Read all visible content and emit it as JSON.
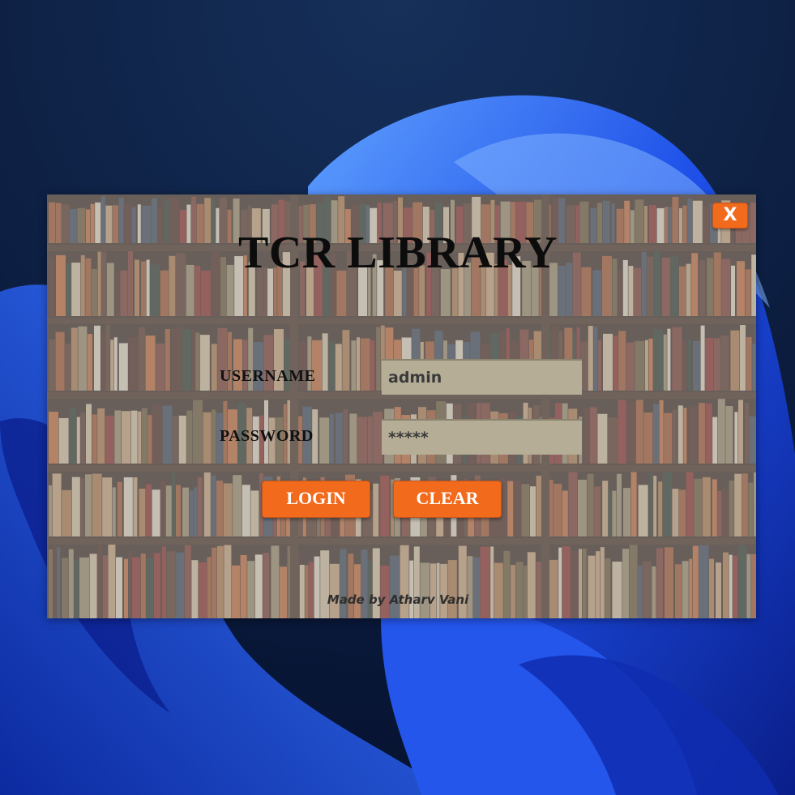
{
  "window": {
    "title": "TCR LIBRARY",
    "close_label": "X"
  },
  "form": {
    "username_label": "USERNAME",
    "username_value": "admin",
    "password_label": "PASSWORD",
    "password_value": "*****"
  },
  "buttons": {
    "login_label": "LOGIN",
    "clear_label": "CLEAR"
  },
  "footer": {
    "credit": "Made by Atharv Vani"
  },
  "colors": {
    "accent": "#f26a1b",
    "input_bg": "#b5ad96",
    "wallpaper_blue": "#1f4fe0"
  }
}
